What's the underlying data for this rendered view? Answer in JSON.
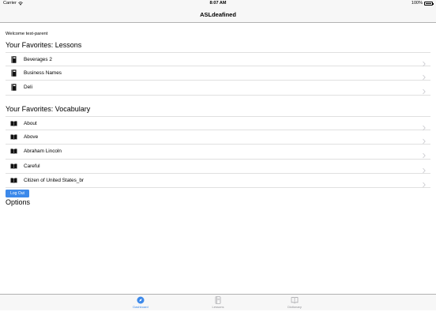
{
  "status_bar": {
    "carrier": "Carrier",
    "time": "8:07 AM",
    "battery": "100%"
  },
  "nav": {
    "title": "ASLdeafined"
  },
  "welcome": "Welcome test-parent",
  "lessons": {
    "title": "Your Favorites: Lessons",
    "items": [
      "Beverages 2",
      "Business Names",
      "Deli"
    ]
  },
  "vocabulary": {
    "title": "Your Favorites: Vocabulary",
    "items": [
      "About",
      "Above",
      "Abraham Lincoln",
      "Careful",
      "Citizen of United States_br"
    ]
  },
  "options": {
    "title": "Options",
    "logout_label": "Log Out"
  },
  "tab_bar": {
    "tabs": [
      {
        "label": "Dashboard",
        "icon": "compass-icon",
        "active": true
      },
      {
        "label": "Lessons",
        "icon": "notebook-icon",
        "active": false
      },
      {
        "label": "Dictionary",
        "icon": "book-icon",
        "active": false
      }
    ]
  },
  "colors": {
    "accent": "#3c89ea",
    "inactive": "#8e8e93",
    "bar_bg": "#f7f7f7"
  }
}
